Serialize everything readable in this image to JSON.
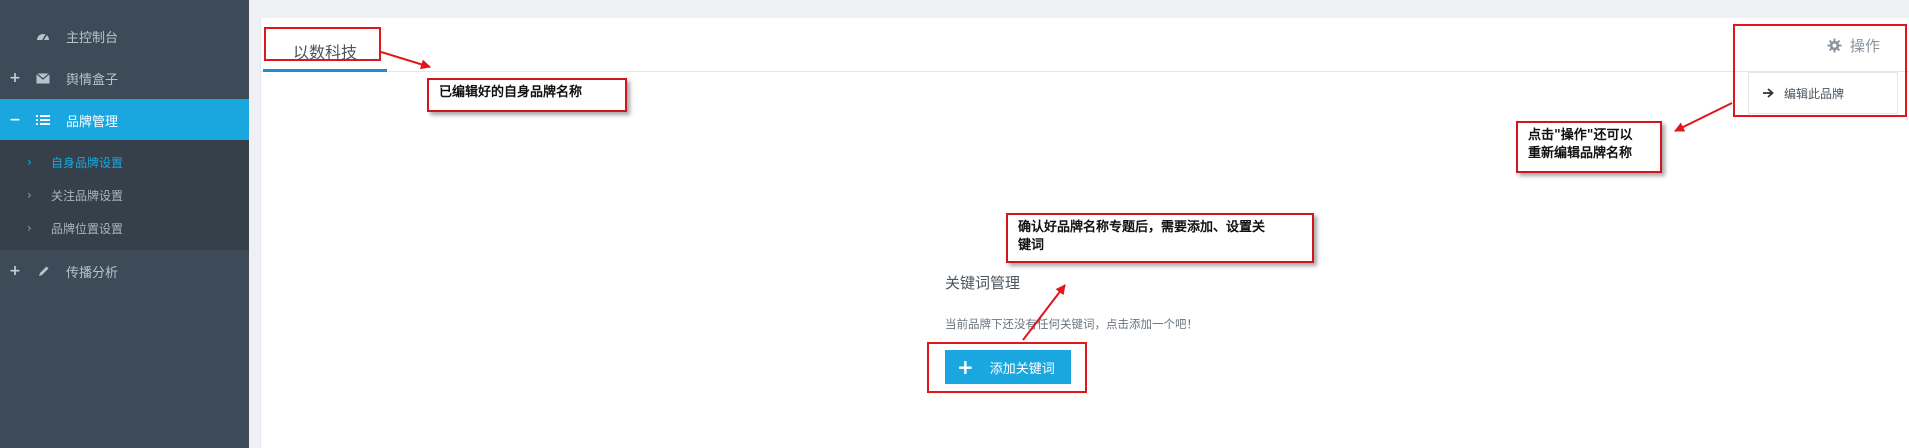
{
  "sidebar": {
    "items": [
      {
        "label": "主控制台",
        "icon": "dashboard-icon"
      },
      {
        "label": "舆情盒子",
        "icon": "envelope-icon"
      },
      {
        "label": "品牌管理",
        "icon": "list-icon"
      },
      {
        "label": "传播分析",
        "icon": "pencil-icon"
      }
    ],
    "subitems": [
      {
        "label": "自身品牌设置"
      },
      {
        "label": "关注品牌设置"
      },
      {
        "label": "品牌位置设置"
      }
    ]
  },
  "main": {
    "tab_label": "以数科技",
    "ops_label": "操作",
    "dropdown_item": "编辑此品牌",
    "keywords_title": "关键词管理",
    "keywords_empty": "当前品牌下还没有任何关键词，点击添加一个吧！",
    "add_button": "添加关键词"
  },
  "annotations": {
    "brand_name": "已编辑好的自身品牌名称",
    "ops_hint_line1": "点击\"操作\"还可以",
    "ops_hint_line2": "重新编辑品牌名称",
    "keyword_hint_line1": "确认好品牌名称专题后，需要添加、设置关",
    "keyword_hint_line2": "键词"
  },
  "colors": {
    "sidebar_bg": "#3d4a57",
    "accent": "#1aa7e0",
    "annotation_red": "#e0161d"
  }
}
